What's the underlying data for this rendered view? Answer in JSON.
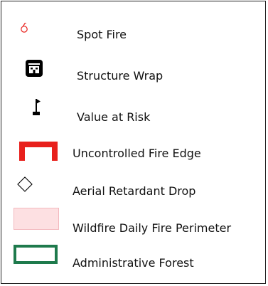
{
  "legend": {
    "items": [
      {
        "label": "Spot Fire",
        "icon": "spot-fire-icon",
        "color": "#e8201c"
      },
      {
        "label": "Structure Wrap",
        "icon": "structure-wrap-icon",
        "color": "#000000"
      },
      {
        "label": "Value at Risk",
        "icon": "value-at-risk-flag-icon",
        "color": "#000000"
      },
      {
        "label": "Uncontrolled Fire Edge",
        "icon": "uncontrolled-fire-edge-icon",
        "color": "#e8201c"
      },
      {
        "label": "Aerial Retardant Drop",
        "icon": "diamond-icon",
        "color": "#000000"
      },
      {
        "label": "Wildfire Daily Fire Perimeter",
        "icon": "fire-perimeter-swatch",
        "color": "#fde0e2"
      },
      {
        "label": "Administrative Forest",
        "icon": "administrative-forest-swatch",
        "color": "#1e7a4c"
      }
    ]
  }
}
